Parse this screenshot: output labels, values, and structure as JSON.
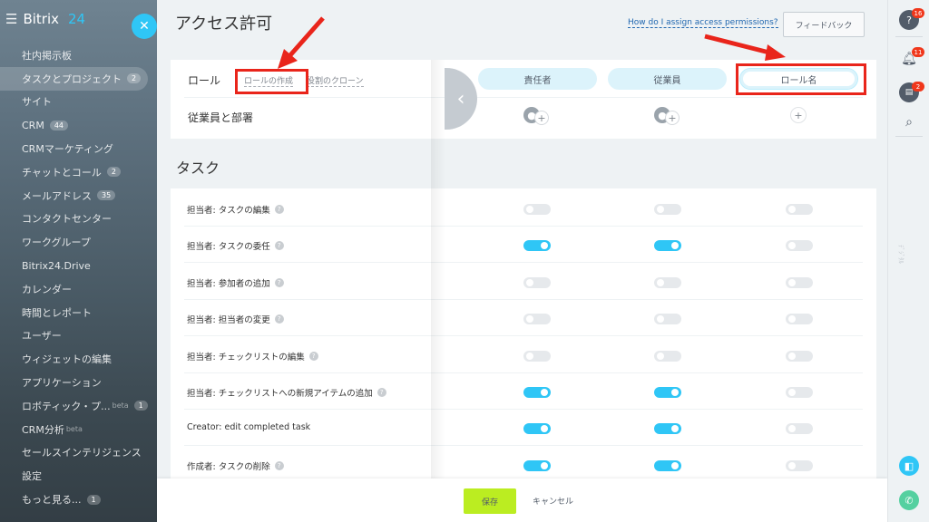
{
  "sidebar": {
    "brand": "Bitrix",
    "brand_suffix": "24",
    "items": [
      {
        "label": "社内掲示板",
        "count": ""
      },
      {
        "label": "タスクとプロジェクト",
        "count": "2"
      },
      {
        "label": "サイト",
        "count": ""
      },
      {
        "label": "CRM",
        "count": "44"
      },
      {
        "label": "CRMマーケティング",
        "count": ""
      },
      {
        "label": "チャットとコール",
        "count": "2"
      },
      {
        "label": "メールアドレス",
        "count": "35"
      },
      {
        "label": "コンタクトセンター",
        "count": ""
      },
      {
        "label": "ワークグループ",
        "count": ""
      },
      {
        "label": "Bitrix24.Drive",
        "count": ""
      },
      {
        "label": "カレンダー",
        "count": ""
      },
      {
        "label": "時間とレポート",
        "count": ""
      },
      {
        "label": "ユーザー",
        "count": ""
      },
      {
        "label": "ウィジェットの編集",
        "count": ""
      },
      {
        "label": "アプリケーション",
        "count": ""
      },
      {
        "label": "ロボティック・プ...",
        "count": "1",
        "beta": "beta"
      },
      {
        "label": "CRM分析",
        "count": "",
        "beta": "beta"
      },
      {
        "label": "セールスインテリジェンス",
        "count": ""
      },
      {
        "label": "設定",
        "count": ""
      },
      {
        "label": "もっと見る...",
        "count": "1"
      }
    ]
  },
  "header": {
    "title": "アクセス許可",
    "help_link": "How do I assign access permissions?",
    "feedback": "フィードバック"
  },
  "roles": {
    "label": "ロール",
    "create": "ロールの作成",
    "clone": "役割のクローン",
    "employees_label": "従業員と部署",
    "columns": [
      "責任者",
      "従業員"
    ],
    "new_role_placeholder": "ロール名"
  },
  "section": {
    "title": "タスク"
  },
  "permissions": [
    {
      "label": "担当者: タスクの編集",
      "help": true,
      "values": [
        false,
        false,
        false
      ]
    },
    {
      "label": "担当者: タスクの委任",
      "help": true,
      "values": [
        true,
        true,
        false
      ]
    },
    {
      "label": "担当者: 参加者の追加",
      "help": true,
      "values": [
        false,
        false,
        false
      ]
    },
    {
      "label": "担当者: 担当者の変更",
      "help": true,
      "values": [
        false,
        false,
        false
      ]
    },
    {
      "label": "担当者: チェックリストの編集",
      "help": true,
      "values": [
        false,
        false,
        false
      ]
    },
    {
      "label": "担当者: チェックリストへの新規アイテムの追加",
      "help": true,
      "values": [
        true,
        true,
        false
      ]
    },
    {
      "label": "Creator: edit completed task",
      "help": false,
      "values": [
        true,
        true,
        false
      ]
    },
    {
      "label": "作成者: タスクの削除",
      "help": true,
      "values": [
        true,
        true,
        false
      ]
    }
  ],
  "footer": {
    "save": "保存",
    "cancel": "キャンセル"
  },
  "rightbar": {
    "badges": [
      "16",
      "11",
      "2"
    ],
    "vertical_label": "ﾃﾞｼﾞﾀﾙ"
  },
  "colors": {
    "accent": "#2fc6f6",
    "save": "#bbed21",
    "annotation": "#e9251b"
  }
}
